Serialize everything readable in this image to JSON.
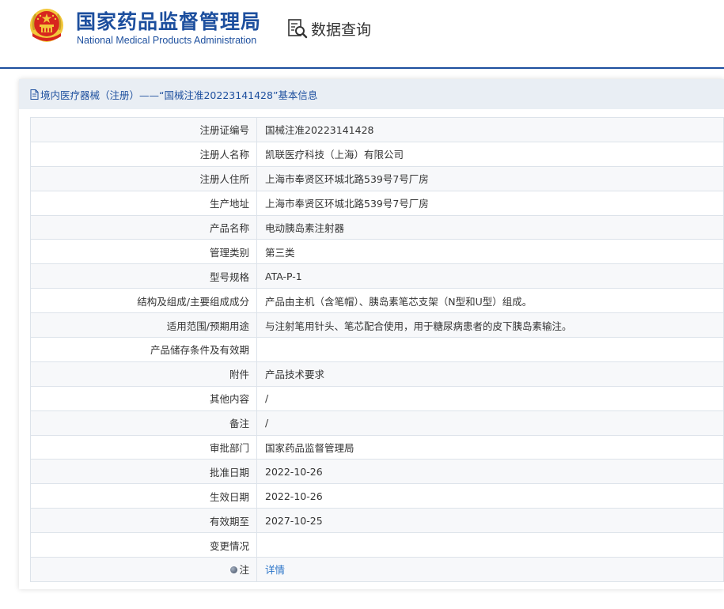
{
  "header": {
    "title_cn": "国家药品监督管理局",
    "title_en": "National Medical Products Administration",
    "data_query_label": "数据查询"
  },
  "panel": {
    "title": "境内医疗器械（注册）——“国械注准20223141428”基本信息"
  },
  "rows": [
    {
      "label": "注册证编号",
      "value": "国械注准20223141428"
    },
    {
      "label": "注册人名称",
      "value": "凯联医疗科技（上海）有限公司"
    },
    {
      "label": "注册人住所",
      "value": "上海市奉贤区环城北路539号7号厂房"
    },
    {
      "label": "生产地址",
      "value": "上海市奉贤区环城北路539号7号厂房"
    },
    {
      "label": "产品名称",
      "value": "电动胰岛素注射器"
    },
    {
      "label": "管理类别",
      "value": "第三类"
    },
    {
      "label": "型号规格",
      "value": "ATA-P-1"
    },
    {
      "label": "结构及组成/主要组成成分",
      "value": "产品由主机（含笔帽）、胰岛素笔芯支架（N型和U型）组成。"
    },
    {
      "label": "适用范围/预期用途",
      "value": "与注射笔用针头、笔芯配合使用，用于糖尿病患者的皮下胰岛素输注。"
    },
    {
      "label": "产品储存条件及有效期",
      "value": ""
    },
    {
      "label": "附件",
      "value": "产品技术要求"
    },
    {
      "label": "其他内容",
      "value": "/"
    },
    {
      "label": "备注",
      "value": "/"
    },
    {
      "label": "审批部门",
      "value": "国家药品监督管理局"
    },
    {
      "label": "批准日期",
      "value": "2022-10-26"
    },
    {
      "label": "生效日期",
      "value": "2022-10-26"
    },
    {
      "label": "有效期至",
      "value": "2027-10-25"
    },
    {
      "label": "变更情况",
      "value": ""
    }
  ],
  "note_row": {
    "label": "注",
    "link_text": "详情"
  },
  "colors": {
    "brand_blue": "#1d4f9e",
    "link_blue": "#2b74c8",
    "emblem_red": "#d7261e",
    "emblem_gold": "#f3c83b"
  },
  "icons": {
    "emblem": "national-emblem-icon",
    "data_query": "search-document-icon",
    "panel_title": "document-icon",
    "note": "bullet-dot-icon"
  }
}
